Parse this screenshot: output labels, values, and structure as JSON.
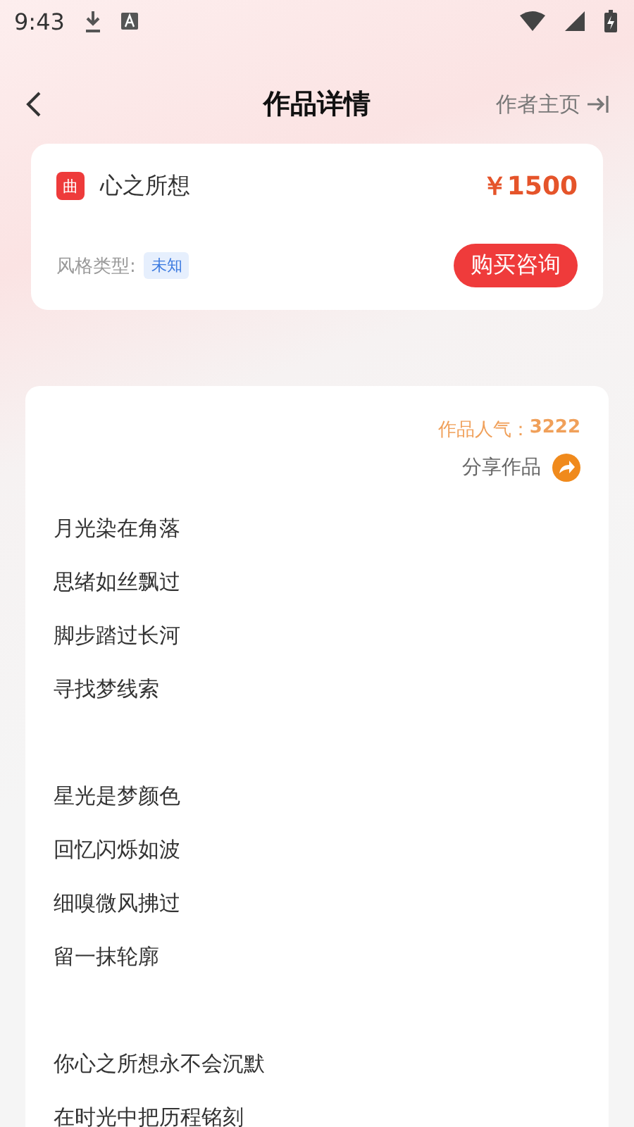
{
  "status_bar": {
    "time": "9:43"
  },
  "header": {
    "title": "作品详情",
    "author_link": "作者主页"
  },
  "work": {
    "badge": "曲",
    "title": "心之所想",
    "price": "￥1500",
    "style_label": "风格类型:",
    "style_tag": "未知",
    "buy_button": "购买咨询"
  },
  "stats": {
    "popularity_label": "作品人气：",
    "popularity_value": "3222",
    "share": "分享作品"
  },
  "lyrics": [
    {
      "lines": [
        "月光染在角落",
        "思绪如丝飘过",
        "脚步踏过长河",
        "寻找梦线索"
      ]
    },
    {
      "lines": [
        "星光是梦颜色",
        "回忆闪烁如波",
        "细嗅微风拂过",
        "留一抹轮廓"
      ]
    },
    {
      "lines": [
        "你心之所想永不会沉默",
        "在时光中把历程铭刻"
      ]
    }
  ]
}
